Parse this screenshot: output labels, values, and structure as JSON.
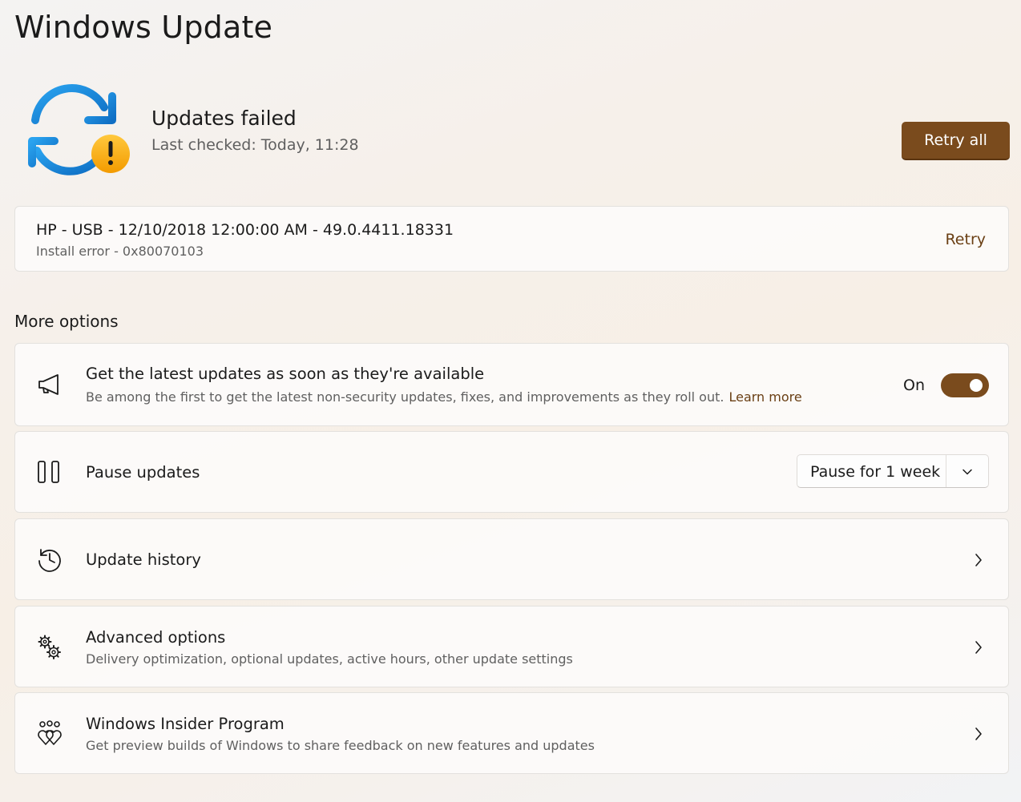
{
  "page": {
    "title": "Windows Update"
  },
  "status": {
    "title": "Updates failed",
    "last_checked": "Last checked: Today, 11:28",
    "retry_all_label": "Retry all"
  },
  "failed_update": {
    "name": "HP - USB - 12/10/2018 12:00:00 AM - 49.0.4411.18331",
    "error": "Install error - 0x80070103",
    "retry_label": "Retry"
  },
  "more_options": {
    "heading": "More options",
    "latest_updates": {
      "title": "Get the latest updates as soon as they're available",
      "description": "Be among the first to get the latest non-security updates, fixes, and improvements as they roll out.",
      "learn_more": "Learn more",
      "toggle_state": "On"
    },
    "pause": {
      "title": "Pause updates",
      "selected": "Pause for 1 week"
    },
    "history": {
      "title": "Update history"
    },
    "advanced": {
      "title": "Advanced options",
      "description": "Delivery optimization, optional updates, active hours, other update settings"
    },
    "insider": {
      "title": "Windows Insider Program",
      "description": "Get preview builds of Windows to share feedback on new features and updates"
    }
  },
  "icons": {
    "status": "sync-warning-icon",
    "latest": "megaphone-icon",
    "pause": "pause-icon",
    "history": "history-icon",
    "advanced": "gears-icon",
    "insider": "insider-hearts-icon",
    "chevron": "chevron-right-icon"
  },
  "colors": {
    "accent": "#7a4b1d",
    "sync_blue": "#1a8fe0",
    "warning": "#f5a10f"
  }
}
